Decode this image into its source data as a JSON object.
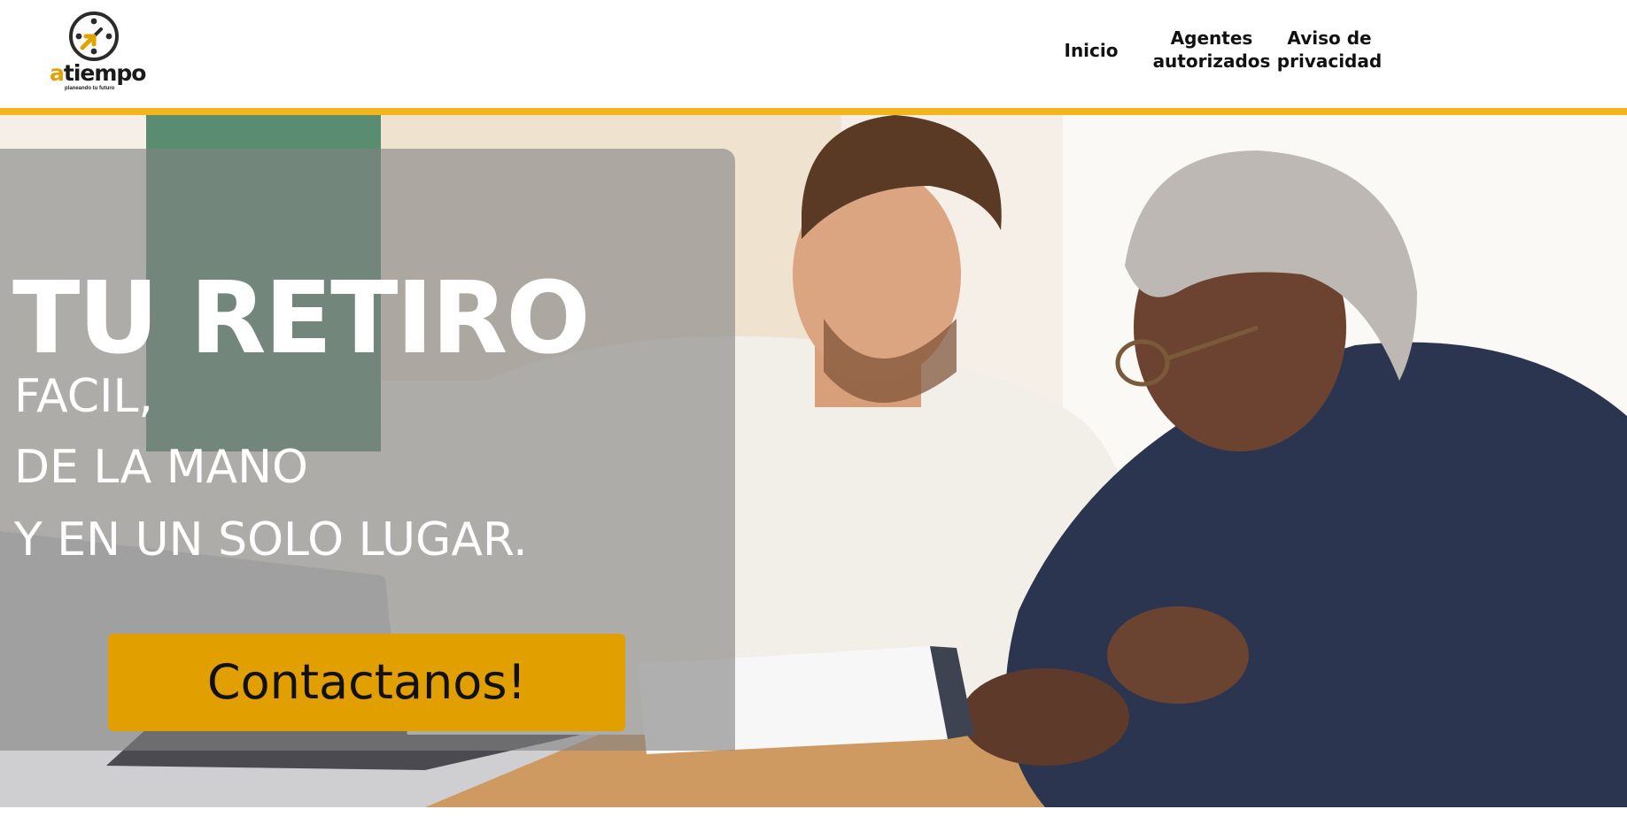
{
  "brand": {
    "name_prefix": "a",
    "name_rest": "tiempo",
    "tagline": "planeando tu futuro",
    "accent_color": "#e2a200",
    "icon": "clock-arrow-icon"
  },
  "nav": {
    "items": [
      {
        "line1": "Inicio",
        "line2": ""
      },
      {
        "line1": "Agentes",
        "line2": "autorizados"
      },
      {
        "line1": "Aviso de",
        "line2": "privacidad"
      }
    ]
  },
  "hero": {
    "headline": "TU RETIRO",
    "lines": [
      "FACIL,",
      "DE LA MANO",
      "Y EN UN SOLO LUGAR."
    ],
    "cta_label": "Contactanos!",
    "cta_color": "#e29f00",
    "divider_color": "#f2b51b"
  }
}
